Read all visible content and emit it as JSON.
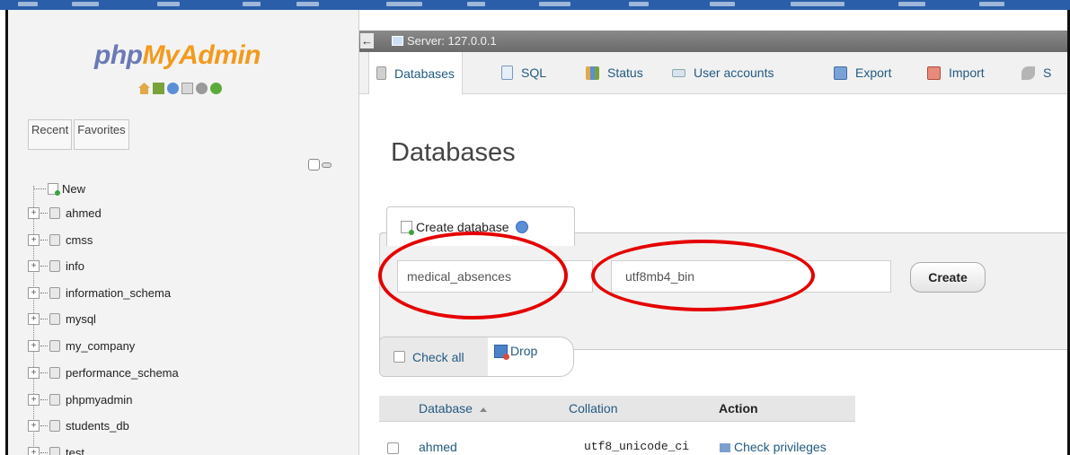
{
  "sidebar": {
    "logo_php": "php",
    "logo_myadmin": "MyAdmin",
    "tabs": {
      "recent": "Recent",
      "favorites": "Favorites"
    },
    "new_label": "New",
    "databases": [
      "ahmed",
      "cmss",
      "info",
      "information_schema",
      "mysql",
      "my_company",
      "performance_schema",
      "phpmyadmin",
      "students_db",
      "test"
    ]
  },
  "serverbar": {
    "label": "Server: 127.0.0.1"
  },
  "navtabs": {
    "databases": "Databases",
    "sql": "SQL",
    "status": "Status",
    "user_accounts": "User accounts",
    "export": "Export",
    "import": "Import",
    "settings": "S"
  },
  "page": {
    "title": "Databases"
  },
  "create": {
    "legend": "Create database",
    "name_value": "medical_absences",
    "collation_value": "utf8mb4_bin",
    "button": "Create"
  },
  "bulk": {
    "check_all": "Check all",
    "drop": "Drop"
  },
  "table": {
    "headers": {
      "database": "Database",
      "collation": "Collation",
      "action": "Action"
    },
    "rows": [
      {
        "database": "ahmed",
        "collation": "utf8_unicode_ci",
        "action": "Check privileges"
      }
    ]
  },
  "colors": {
    "annotation": "#e50000",
    "link": "#235a81",
    "logo_php": "#6a79b7",
    "logo_myadmin": "#f39a1e",
    "taskbar": "#2a5ea8"
  }
}
